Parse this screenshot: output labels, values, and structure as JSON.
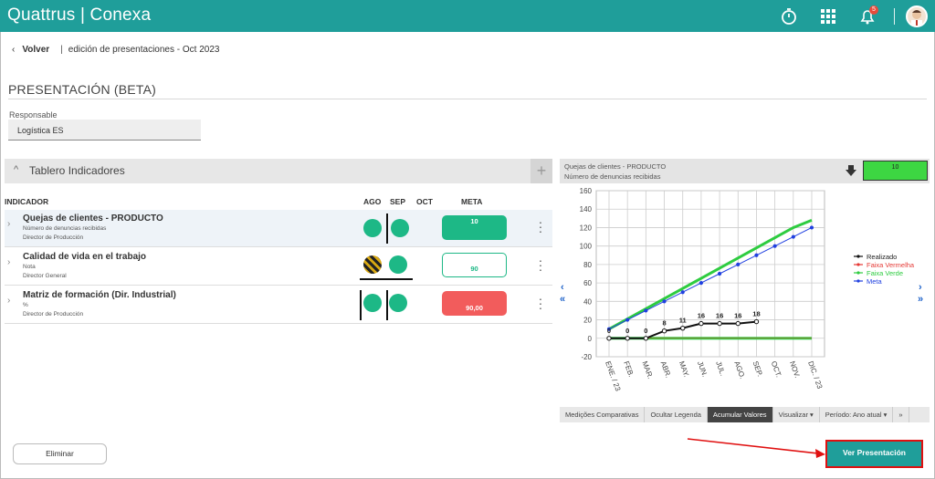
{
  "app": {
    "title": "Quattrus | Conexa",
    "notif_count": "5"
  },
  "icons": {
    "timer": "stopwatch-icon",
    "grid": "apps-grid-icon",
    "bell": "bell-icon",
    "back": "chevron-left-icon"
  },
  "breadcrumb": {
    "back_label": "Volver",
    "page": "edición de presentaciones - Oct 2023"
  },
  "page": {
    "title": "PRESENTACIÓN (BETA)"
  },
  "responsable": {
    "label": "Responsable",
    "value": "Logística ES"
  },
  "board": {
    "title": "Tablero Indicadores",
    "headers": {
      "indicador": "INDICADOR",
      "ago": "AGO",
      "sep": "SEP",
      "oct": "OCT",
      "meta": "META"
    },
    "rows": [
      {
        "name": "Quejas de clientes - PRODUCTO",
        "unit": "Número de denuncias recibidas",
        "resp": "Director de Producción",
        "meta": "10",
        "meta_color": "#1db886",
        "ago": "green",
        "sep": "green"
      },
      {
        "name": "Calidad de vida en el trabajo",
        "unit": "Nota",
        "resp": "Director General",
        "meta": "90",
        "meta_color": "#ffffff",
        "ago": "striped",
        "sep": "green"
      },
      {
        "name": "Matriz de formación (Dir. Industrial)",
        "unit": "%",
        "resp": "Director de Producción",
        "meta": "90,00",
        "meta_color": "#f25c5c",
        "ago": "green",
        "sep": "green"
      }
    ]
  },
  "chart_head": {
    "line1": "Quejas de clientes - PRODUCTO",
    "line2": "Número de denuncias recibidas",
    "box_value": "10"
  },
  "chart_data": {
    "type": "line",
    "categories": [
      "ENE. / 23",
      "FEB.",
      "MAR.",
      "ABR.",
      "MAY.",
      "JUN.",
      "JUL.",
      "AGO.",
      "SEP.",
      "OCT.",
      "NOV.",
      "DIC. / 23"
    ],
    "ylim": [
      -20,
      160
    ],
    "yticks": [
      -20,
      0,
      20,
      40,
      60,
      80,
      100,
      120,
      140,
      160
    ],
    "grid": true,
    "legend_position": "right",
    "series": [
      {
        "name": "Realizado",
        "color": "#111111",
        "values": [
          0,
          0,
          0,
          8,
          11,
          16,
          16,
          16,
          18,
          null,
          null,
          null
        ],
        "labels": true
      },
      {
        "name": "Faixa Vermelha",
        "color": "#e53935",
        "values": [
          0,
          0,
          0,
          0,
          0,
          0,
          0,
          0,
          0,
          0,
          0,
          0
        ]
      },
      {
        "name": "Faixa Verde",
        "color": "#2ecc40",
        "values": [
          0,
          0,
          0,
          0,
          0,
          0,
          0,
          0,
          0,
          0,
          0,
          0
        ],
        "values2": [
          10,
          21,
          32,
          43,
          54,
          65,
          76,
          87,
          98,
          109,
          120,
          128
        ]
      },
      {
        "name": "Meta",
        "color": "#2040e0",
        "values": [
          10,
          20,
          30,
          40,
          50,
          60,
          70,
          80,
          90,
          100,
          110,
          120
        ]
      }
    ]
  },
  "chart_tabs": [
    "Medições Comparativas",
    "Ocultar Legenda",
    "Acumular Valores",
    "Visualizar ▾",
    "Período: Ano atual ▾",
    "»"
  ],
  "actions": {
    "eliminar": "Eliminar",
    "ver": "Ver Presentación"
  }
}
